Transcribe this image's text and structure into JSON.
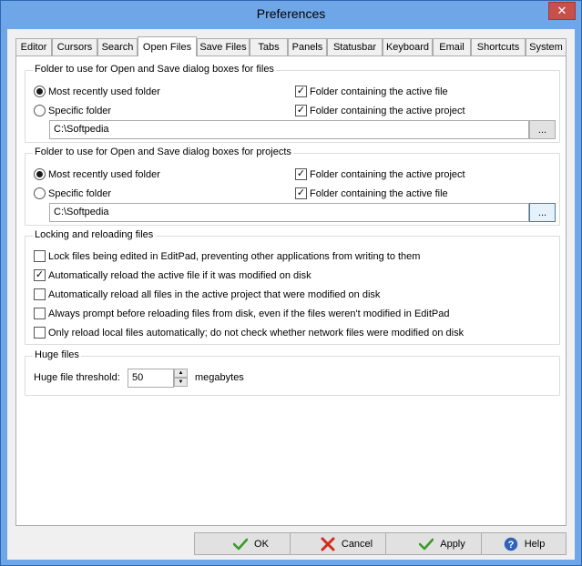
{
  "window": {
    "title": "Preferences",
    "close_glyph": "✕"
  },
  "tabs": [
    {
      "label": "Editor"
    },
    {
      "label": "Cursors"
    },
    {
      "label": "Search"
    },
    {
      "label": "Open Files",
      "active": true
    },
    {
      "label": "Save Files"
    },
    {
      "label": "Tabs"
    },
    {
      "label": "Panels"
    },
    {
      "label": "Statusbar"
    },
    {
      "label": "Keyboard"
    },
    {
      "label": "Email"
    },
    {
      "label": "Shortcuts"
    },
    {
      "label": "System"
    }
  ],
  "files_folder": {
    "title": "Folder to use for Open and Save dialog boxes for files",
    "most_recent": "Most recently used folder",
    "specific": "Specific folder",
    "active_file": "Folder containing the active file",
    "active_project": "Folder containing the active project",
    "path": "C:\\Softpedia",
    "browse": "..."
  },
  "projects_folder": {
    "title": "Folder to use for Open and Save dialog boxes for projects",
    "most_recent": "Most recently used folder",
    "specific": "Specific folder",
    "active_project": "Folder containing the active project",
    "active_file": "Folder containing the active file",
    "path": "C:\\Softpedia",
    "browse": "..."
  },
  "locking": {
    "title": "Locking and reloading files",
    "options": [
      {
        "label": "Lock files being edited in EditPad, preventing other applications from writing to them",
        "checked": false
      },
      {
        "label": "Automatically reload the active file if it was modified on disk",
        "checked": true
      },
      {
        "label": "Automatically reload all files in the active project that were modified on disk",
        "checked": false
      },
      {
        "label": "Always prompt before reloading files from disk, even if the files weren't modified in EditPad",
        "checked": false
      },
      {
        "label": "Only reload local files automatically; do not check whether network files were modified on disk",
        "checked": false
      }
    ]
  },
  "huge": {
    "title": "Huge files",
    "label": "Huge file threshold:",
    "value": "50",
    "unit": "megabytes"
  },
  "buttons": {
    "ok": "OK",
    "cancel": "Cancel",
    "apply": "Apply",
    "help": "Help"
  },
  "colors": {
    "titlebar": "#6ea6e8",
    "ok_check": "#3a9a2a",
    "cancel_x": "#d42a1e",
    "help_blue": "#2f63b8"
  }
}
